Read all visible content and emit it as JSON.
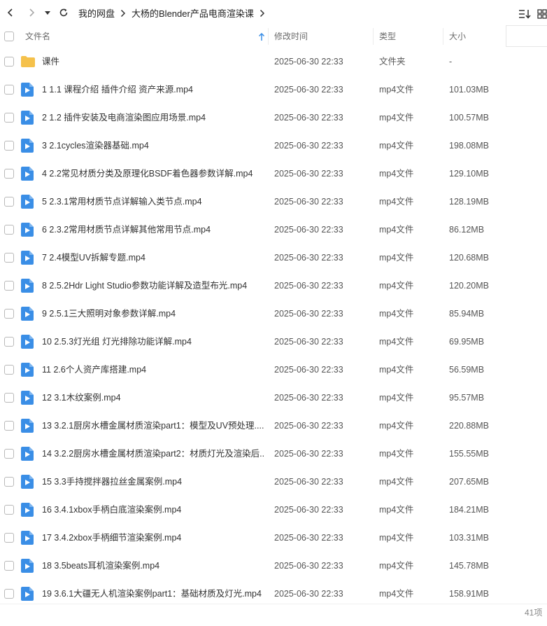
{
  "breadcrumb": [
    "我的网盘",
    "大杨的Blender产品电商渲染课"
  ],
  "header": {
    "name": "文件名",
    "modified": "修改时间",
    "type": "类型",
    "size": "大小"
  },
  "colors": {
    "folder": "#f5c14b",
    "video_icon": "#3a8ee6"
  },
  "files": [
    {
      "name": "课件",
      "time": "2025-06-30 22:33",
      "type": "文件夹",
      "size": "-",
      "icon": "folder-icon"
    },
    {
      "name": "1 1.1 课程介绍 插件介绍 资产来源.mp4",
      "time": "2025-06-30 22:33",
      "type": "mp4文件",
      "size": "101.03MB",
      "icon": "video-file-icon"
    },
    {
      "name": "2 1.2 插件安装及电商渲染图应用场景.mp4",
      "time": "2025-06-30 22:33",
      "type": "mp4文件",
      "size": "100.57MB",
      "icon": "video-file-icon"
    },
    {
      "name": "3 2.1cycles渲染器基础.mp4",
      "time": "2025-06-30 22:33",
      "type": "mp4文件",
      "size": "198.08MB",
      "icon": "video-file-icon"
    },
    {
      "name": "4 2.2常见材质分类及原理化BSDF着色器参数详解.mp4",
      "time": "2025-06-30 22:33",
      "type": "mp4文件",
      "size": "129.10MB",
      "icon": "video-file-icon"
    },
    {
      "name": "5 2.3.1常用材质节点详解输入类节点.mp4",
      "time": "2025-06-30 22:33",
      "type": "mp4文件",
      "size": "128.19MB",
      "icon": "video-file-icon"
    },
    {
      "name": "6 2.3.2常用材质节点详解其他常用节点.mp4",
      "time": "2025-06-30 22:33",
      "type": "mp4文件",
      "size": "86.12MB",
      "icon": "video-file-icon"
    },
    {
      "name": "7 2.4模型UV拆解专题.mp4",
      "time": "2025-06-30 22:33",
      "type": "mp4文件",
      "size": "120.68MB",
      "icon": "video-file-icon"
    },
    {
      "name": "8 2.5.2Hdr Light Studio参数功能详解及造型布光.mp4",
      "time": "2025-06-30 22:33",
      "type": "mp4文件",
      "size": "120.20MB",
      "icon": "video-file-icon"
    },
    {
      "name": "9 2.5.1三大照明对象参数详解.mp4",
      "time": "2025-06-30 22:33",
      "type": "mp4文件",
      "size": "85.94MB",
      "icon": "video-file-icon"
    },
    {
      "name": "10 2.5.3灯光组 灯光排除功能详解.mp4",
      "time": "2025-06-30 22:33",
      "type": "mp4文件",
      "size": "69.95MB",
      "icon": "video-file-icon"
    },
    {
      "name": "11 2.6个人资产库搭建.mp4",
      "time": "2025-06-30 22:33",
      "type": "mp4文件",
      "size": "56.59MB",
      "icon": "video-file-icon"
    },
    {
      "name": "12 3.1木纹案例.mp4",
      "time": "2025-06-30 22:33",
      "type": "mp4文件",
      "size": "95.57MB",
      "icon": "video-file-icon"
    },
    {
      "name": "13 3.2.1厨房水槽金属材质渲染part1：模型及UV预处理....",
      "time": "2025-06-30 22:33",
      "type": "mp4文件",
      "size": "220.88MB",
      "icon": "video-file-icon"
    },
    {
      "name": "14 3.2.2厨房水槽金属材质渲染part2：材质灯光及渲染后...",
      "time": "2025-06-30 22:33",
      "type": "mp4文件",
      "size": "155.55MB",
      "icon": "video-file-icon"
    },
    {
      "name": "15 3.3手持搅拌器拉丝金属案例.mp4",
      "time": "2025-06-30 22:33",
      "type": "mp4文件",
      "size": "207.65MB",
      "icon": "video-file-icon"
    },
    {
      "name": "16 3.4.1xbox手柄白底渲染案例.mp4",
      "time": "2025-06-30 22:33",
      "type": "mp4文件",
      "size": "184.21MB",
      "icon": "video-file-icon"
    },
    {
      "name": "17 3.4.2xbox手柄细节渲染案例.mp4",
      "time": "2025-06-30 22:33",
      "type": "mp4文件",
      "size": "103.31MB",
      "icon": "video-file-icon"
    },
    {
      "name": "18 3.5beats耳机渲染案例.mp4",
      "time": "2025-06-30 22:33",
      "type": "mp4文件",
      "size": "145.78MB",
      "icon": "video-file-icon"
    },
    {
      "name": "19 3.6.1大疆无人机渲染案例part1：基础材质及灯光.mp4",
      "time": "2025-06-30 22:33",
      "type": "mp4文件",
      "size": "158.91MB",
      "icon": "video-file-icon"
    }
  ],
  "footer": {
    "count": "41项"
  }
}
